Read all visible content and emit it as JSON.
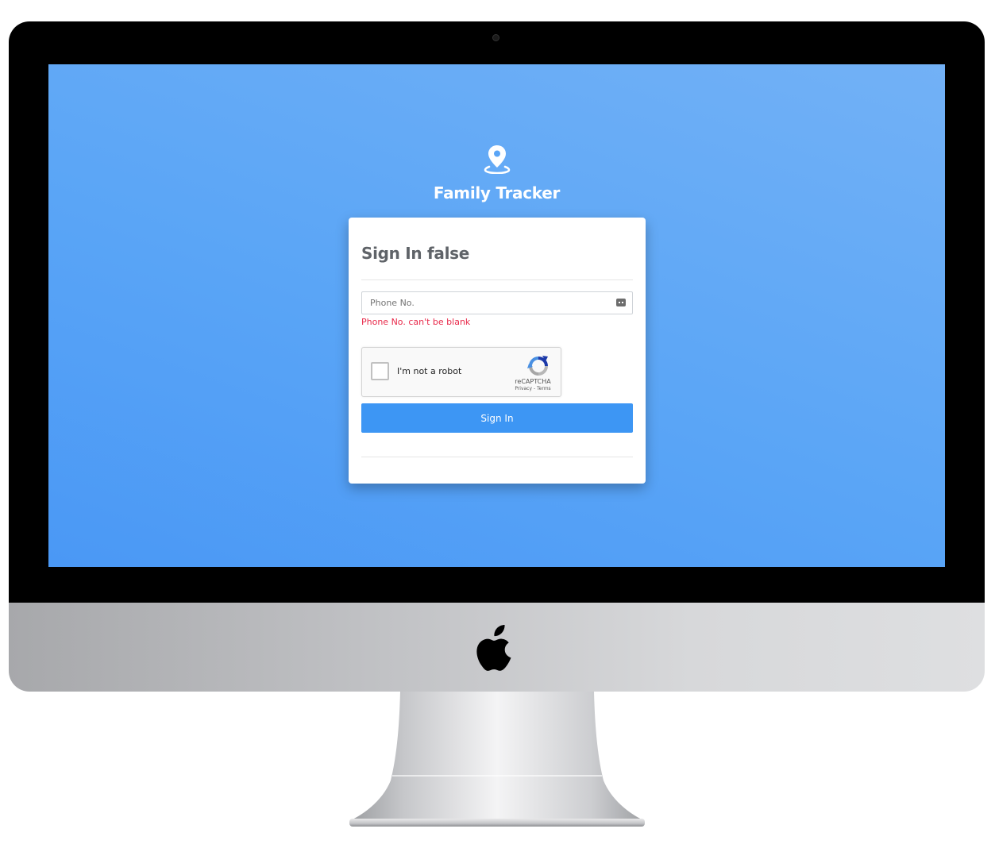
{
  "app": {
    "brand_title": "Family Tracker",
    "brand_icon": "map-pin-icon"
  },
  "signin": {
    "title": "Sign In false",
    "phone_placeholder": "Phone No.",
    "phone_value": "",
    "phone_error": "Phone No. can't be blank",
    "submit_label": "Sign In"
  },
  "recaptcha": {
    "label": "I'm not a robot",
    "brand": "reCAPTCHA",
    "links": "Privacy - Terms",
    "checked": false
  },
  "colors": {
    "background_accent": "#4a98f5",
    "button": "#3d96f4",
    "error": "#e8294a",
    "title_text": "#5f6368"
  }
}
